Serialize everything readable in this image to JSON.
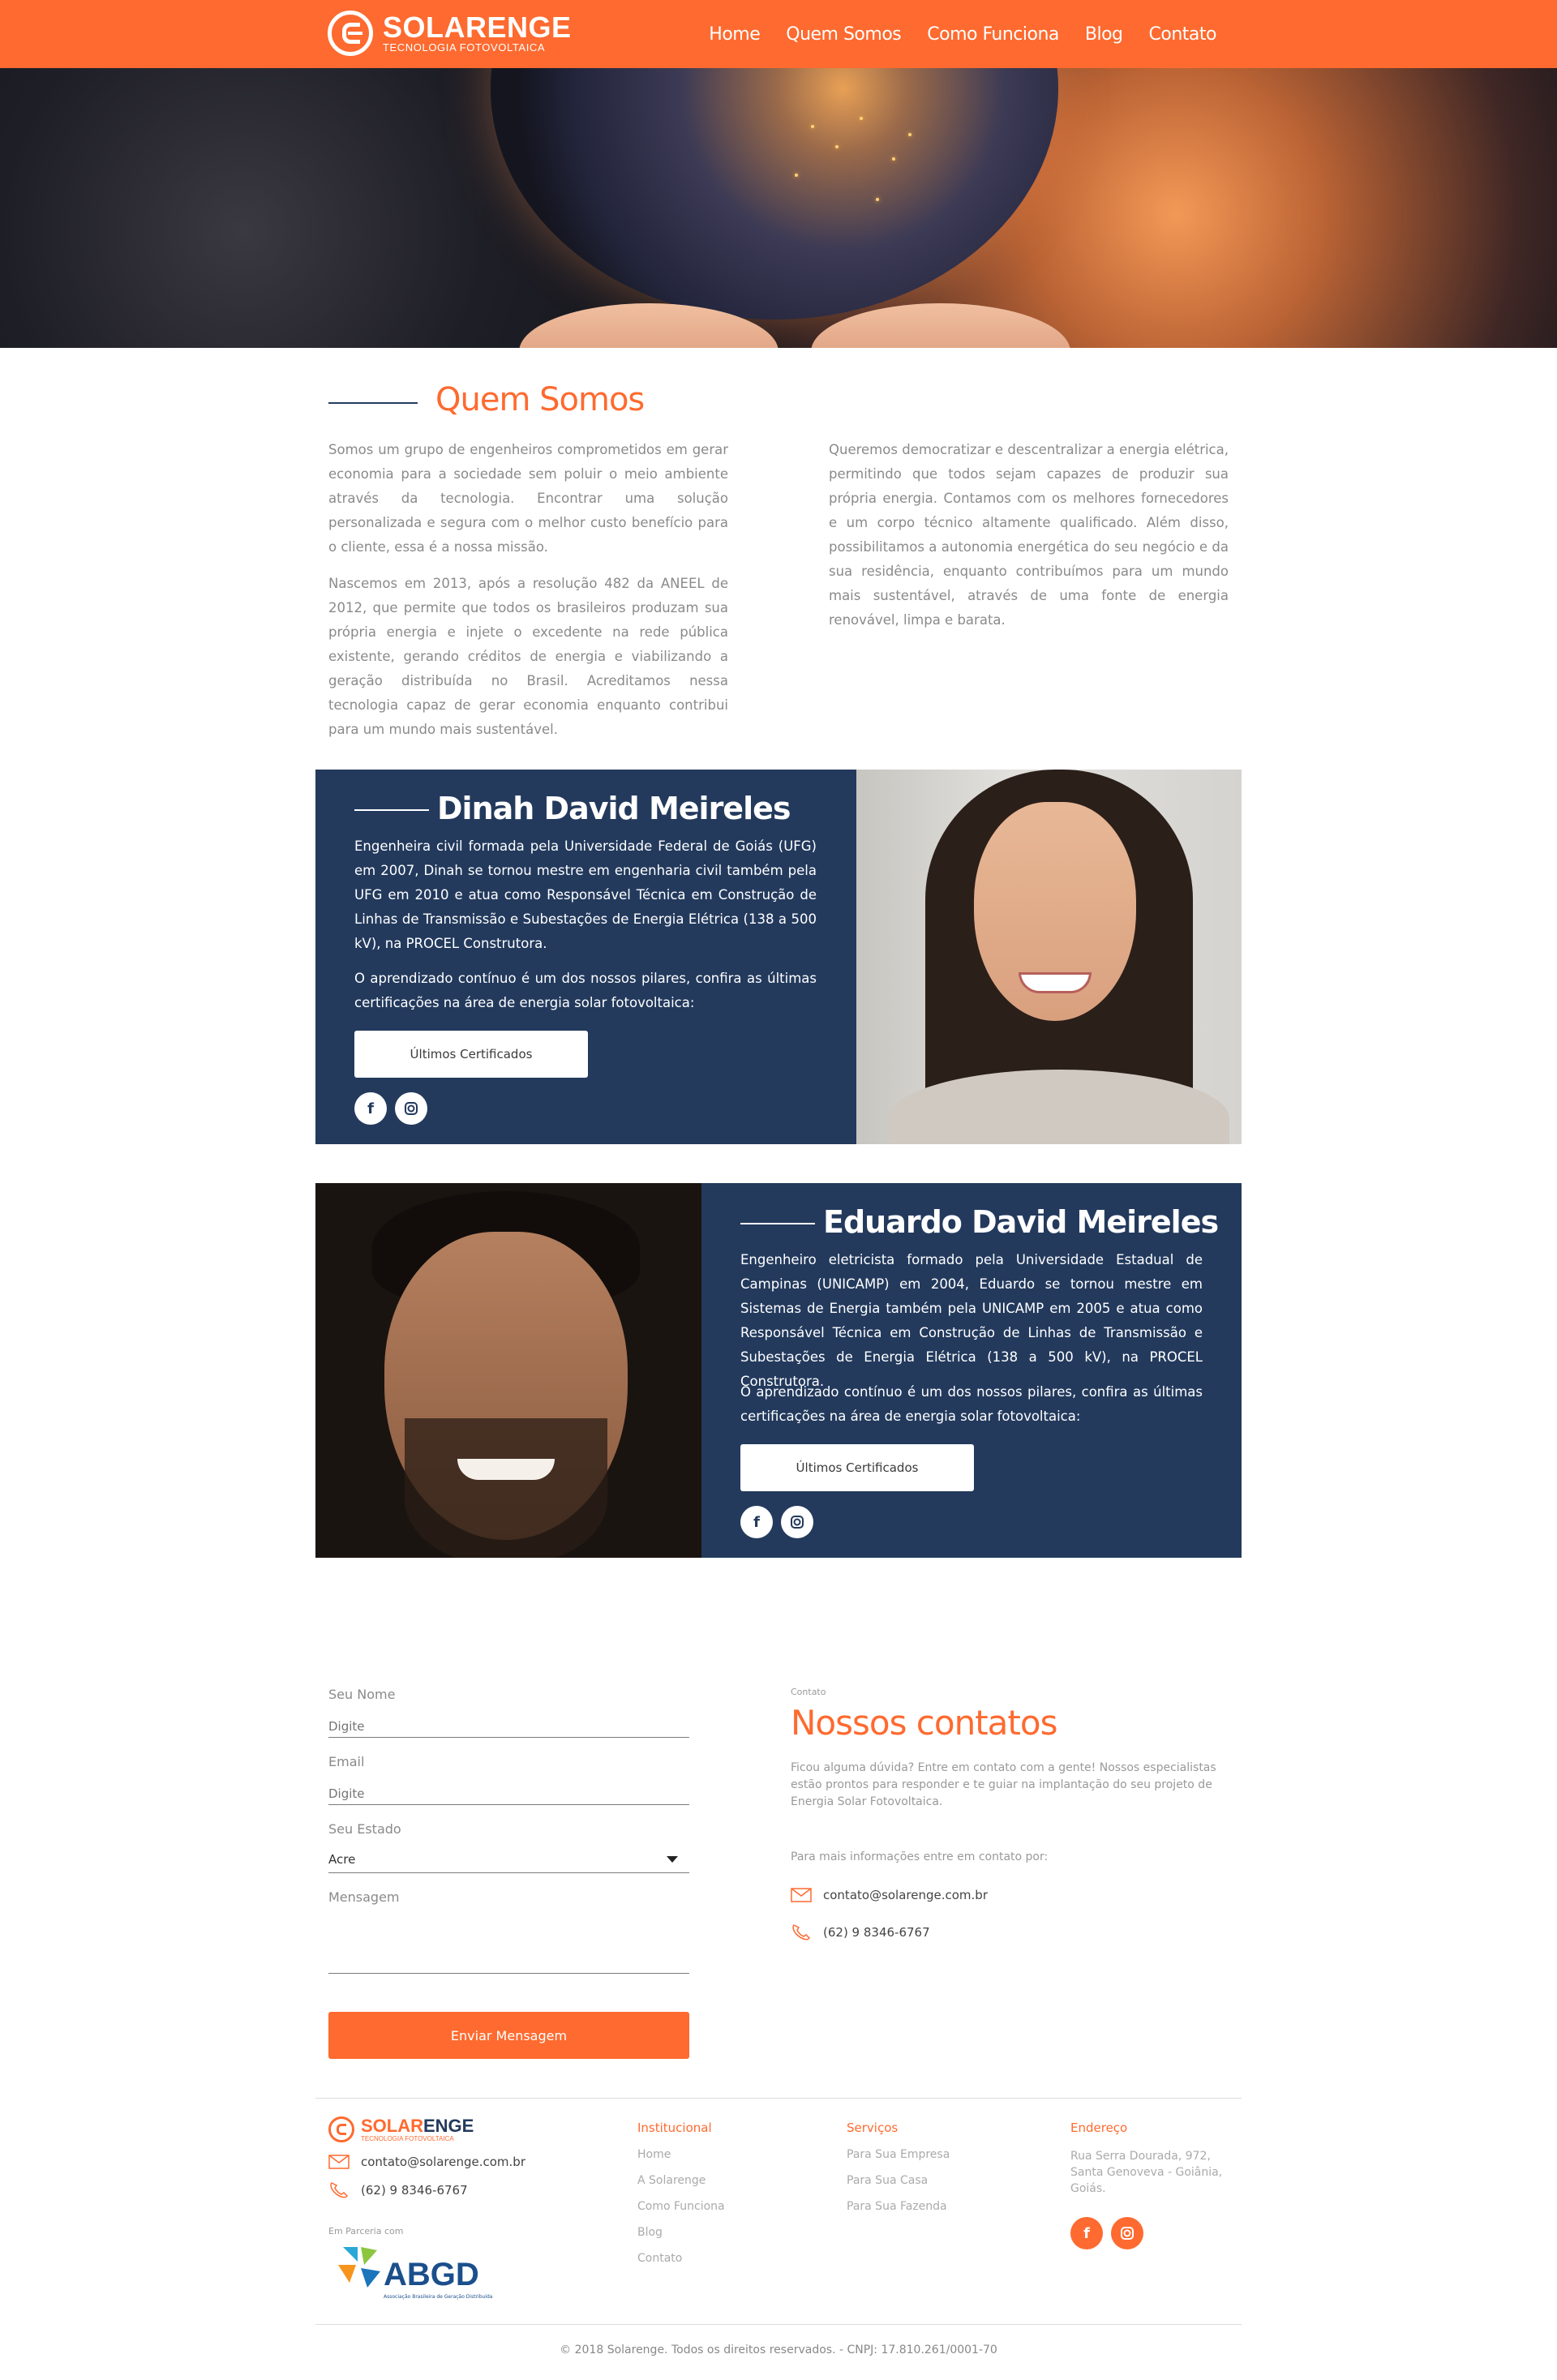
{
  "brand": {
    "name": "SOLARENGE",
    "tagline": "TECNOLOGIA FOTOVOLTAICA",
    "name_part1": "SOLAR",
    "name_part2": "ENGE"
  },
  "nav": {
    "items": [
      "Home",
      "Quem Somos",
      "Como Funciona",
      "Blog",
      "Contato"
    ]
  },
  "about": {
    "title": "Quem Somos",
    "p1": "Somos um grupo de engenheiros comprometidos em gerar economia para a sociedade sem poluir o meio ambiente através da tecnologia. Encontrar uma solução personalizada e segura com o melhor custo benefício para o cliente, essa é a nossa missão.",
    "p2": "Nascemos em 2013, após a resolução 482 da ANEEL de 2012, que permite que todos os brasileiros produzam sua própria energia e injete o excedente na rede pública existente, gerando créditos de energia e viabilizando a geração distribuída no Brasil. Acreditamos nessa tecnologia capaz de gerar economia enquanto contribui para um mundo mais sustentável.",
    "p3": "Queremos democratizar e descentralizar a energia elétrica, permitindo que todos sejam capazes de produzir sua própria energia. Contamos com os melhores fornecedores e um corpo técnico altamente qualificado. Além disso, possibilitamos a autonomia energética do seu negócio e da sua residência, enquanto contribuímos para um mundo mais sustentável, através de uma fonte de energia renovável, limpa e barata."
  },
  "profiles": [
    {
      "name": "Dinah David Meireles",
      "bio": "Engenheira civil formada pela Universidade Federal de Goiás (UFG) em 2007, Dinah se tornou mestre em engenharia civil também pela UFG em 2010 e atua como Responsável Técnica em Construção de Linhas de Transmissão e Subestações de Energia Elétrica (138 a 500 kV), na PROCEL Construtora.",
      "note": "O aprendizado contínuo é um dos nossos pilares, confira as últimas certificações na área de energia solar fotovoltaica:",
      "button": "Últimos Certificados"
    },
    {
      "name": "Eduardo David Meireles",
      "bio": "Engenheiro eletricista formado pela Universidade Estadual de Campinas (UNICAMP) em 2004, Eduardo se tornou mestre em Sistemas de Energia também pela UNICAMP em 2005 e atua como Responsável Técnica em Construção de Linhas de Transmissão e Subestações de Energia Elétrica (138 a 500 kV), na PROCEL Construtora.",
      "note": "O aprendizado contínuo é um dos nossos pilares, confira as últimas certificações na área de energia solar fotovoltaica:",
      "button": "Últimos Certificados"
    }
  ],
  "form": {
    "name_label": "Seu Nome",
    "name_placeholder": "Digite",
    "email_label": "Email",
    "email_placeholder": "Digite",
    "state_label": "Seu Estado",
    "state_value": "Acre",
    "message_label": "Mensagem",
    "submit": "Enviar Mensagem"
  },
  "contact": {
    "kicker": "Contato",
    "title": "Nossos contatos",
    "description": "Ficou alguma dúvida? Entre em contato com a gente! Nossos especialistas estão prontos para responder e te guiar na implantação do seu projeto de Energia Solar Fotovoltaica.",
    "more": "Para mais informações entre em contato por:",
    "email": "contato@solarenge.com.br",
    "phone": "(62) 9 8346-6767"
  },
  "footer": {
    "email": "contato@solarenge.com.br",
    "phone": "(62) 9 8346-6767",
    "partner_label": "Em Parceria com",
    "partner_name": "ABGD",
    "partner_sub": "Associação Brasileira de Geração Distribuída",
    "institucional": {
      "title": "Institucional",
      "items": [
        "Home",
        "A Solarenge",
        "Como Funciona",
        "Blog",
        "Contato"
      ]
    },
    "servicos": {
      "title": "Serviços",
      "items": [
        "Para Sua Empresa",
        "Para Sua Casa",
        "Para Sua Fazenda"
      ]
    },
    "endereco": {
      "title": "Endereço",
      "text": "Rua Serra Dourada, 972, Santa Genoveva - Goiânia, Goiás."
    },
    "copyright": "© 2018 Solarenge. Todos os direitos reservados. - CNPJ: 17.810.261/0001-70"
  },
  "colors": {
    "accent": "#fe6a2f",
    "navy": "#233a5d"
  }
}
